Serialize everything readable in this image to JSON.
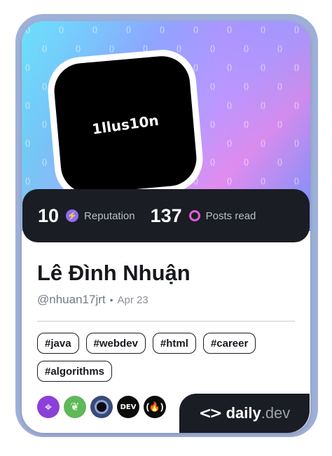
{
  "profile": {
    "avatar_text": "1llus10n",
    "name": "Lê Đình Nhuận",
    "handle": "@nhuan17jrt",
    "separator": "•",
    "joined": "Apr 23"
  },
  "stats": {
    "reputation_value": "10",
    "reputation_label": "Reputation",
    "posts_value": "137",
    "posts_label": "Posts read"
  },
  "tags": [
    "#java",
    "#webdev",
    "#html",
    "#career",
    "#algorithms"
  ],
  "badges": [
    {
      "icon": "crosshair-icon",
      "glyph": "⌖"
    },
    {
      "icon": "spring-leaf-icon",
      "glyph": "❦"
    },
    {
      "icon": "orbit-icon",
      "glyph": ""
    },
    {
      "icon": "dev-logo-icon",
      "glyph": "DEV"
    },
    {
      "icon": "freecodecamp-icon",
      "glyph": "(🔥)"
    }
  ],
  "brand": {
    "mark_glyph": "<>",
    "name": "daily",
    "tld": ".dev"
  },
  "colors": {
    "card_frame": "#9fb0d8",
    "dark_surface": "#1a1d23",
    "reputation_accent": "#8b6cff",
    "posts_accent": "#e05cd6"
  }
}
